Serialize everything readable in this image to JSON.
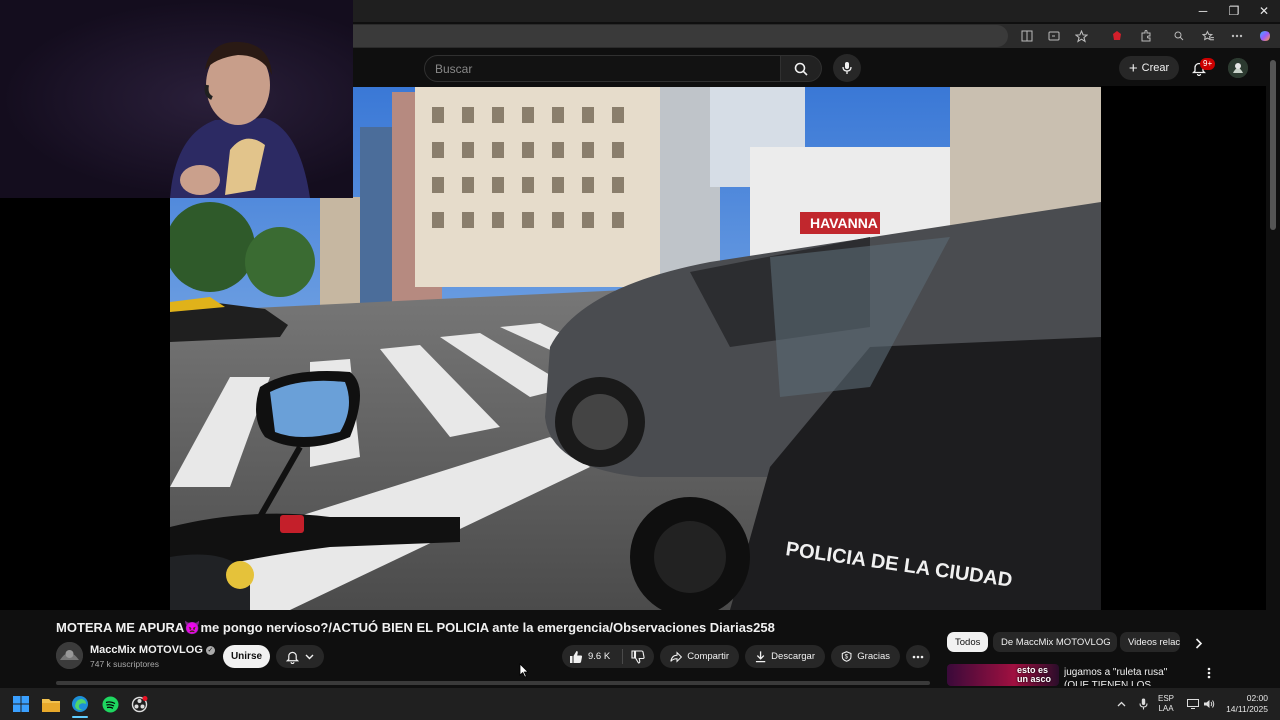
{
  "browser": {
    "minimize": "─",
    "restore": "❐",
    "close": "✕"
  },
  "youtube": {
    "search_placeholder": "Buscar",
    "create_label": "Crear",
    "notification_count": "9+"
  },
  "video": {
    "title": "MOTERA ME APURA👿me pongo nervioso?/ACTUÓ BIEN EL POLICIA ante la emergencia/Observaciones Diarias258",
    "overlay_text": "POLICIA DE LA CIUDAD",
    "shop_sign": "HAVANNA"
  },
  "channel": {
    "name": "MaccMix MOTOVLOG",
    "subscribers": "747 k suscriptores",
    "join_label": "Unirse"
  },
  "actions": {
    "likes": "9.6 K",
    "share_label": "Compartir",
    "download_label": "Descargar",
    "thanks_label": "Gracias"
  },
  "chips": [
    "Todos",
    "De MaccMix MOTOVLOG",
    "Videos relacionados"
  ],
  "related": {
    "thumb_text": "esto es un asco",
    "title": "jugamos a \"ruleta rusa\" (QUE TIENEN LOS VASOS???)"
  },
  "taskbar": {
    "lang_top": "ESP",
    "lang_bottom": "LAA",
    "time": "02:00",
    "date": "14/11/2025"
  },
  "colors": {
    "background": "#0f0f0f",
    "chip_active": "#f1f1f1",
    "badge": "#cc0000"
  }
}
